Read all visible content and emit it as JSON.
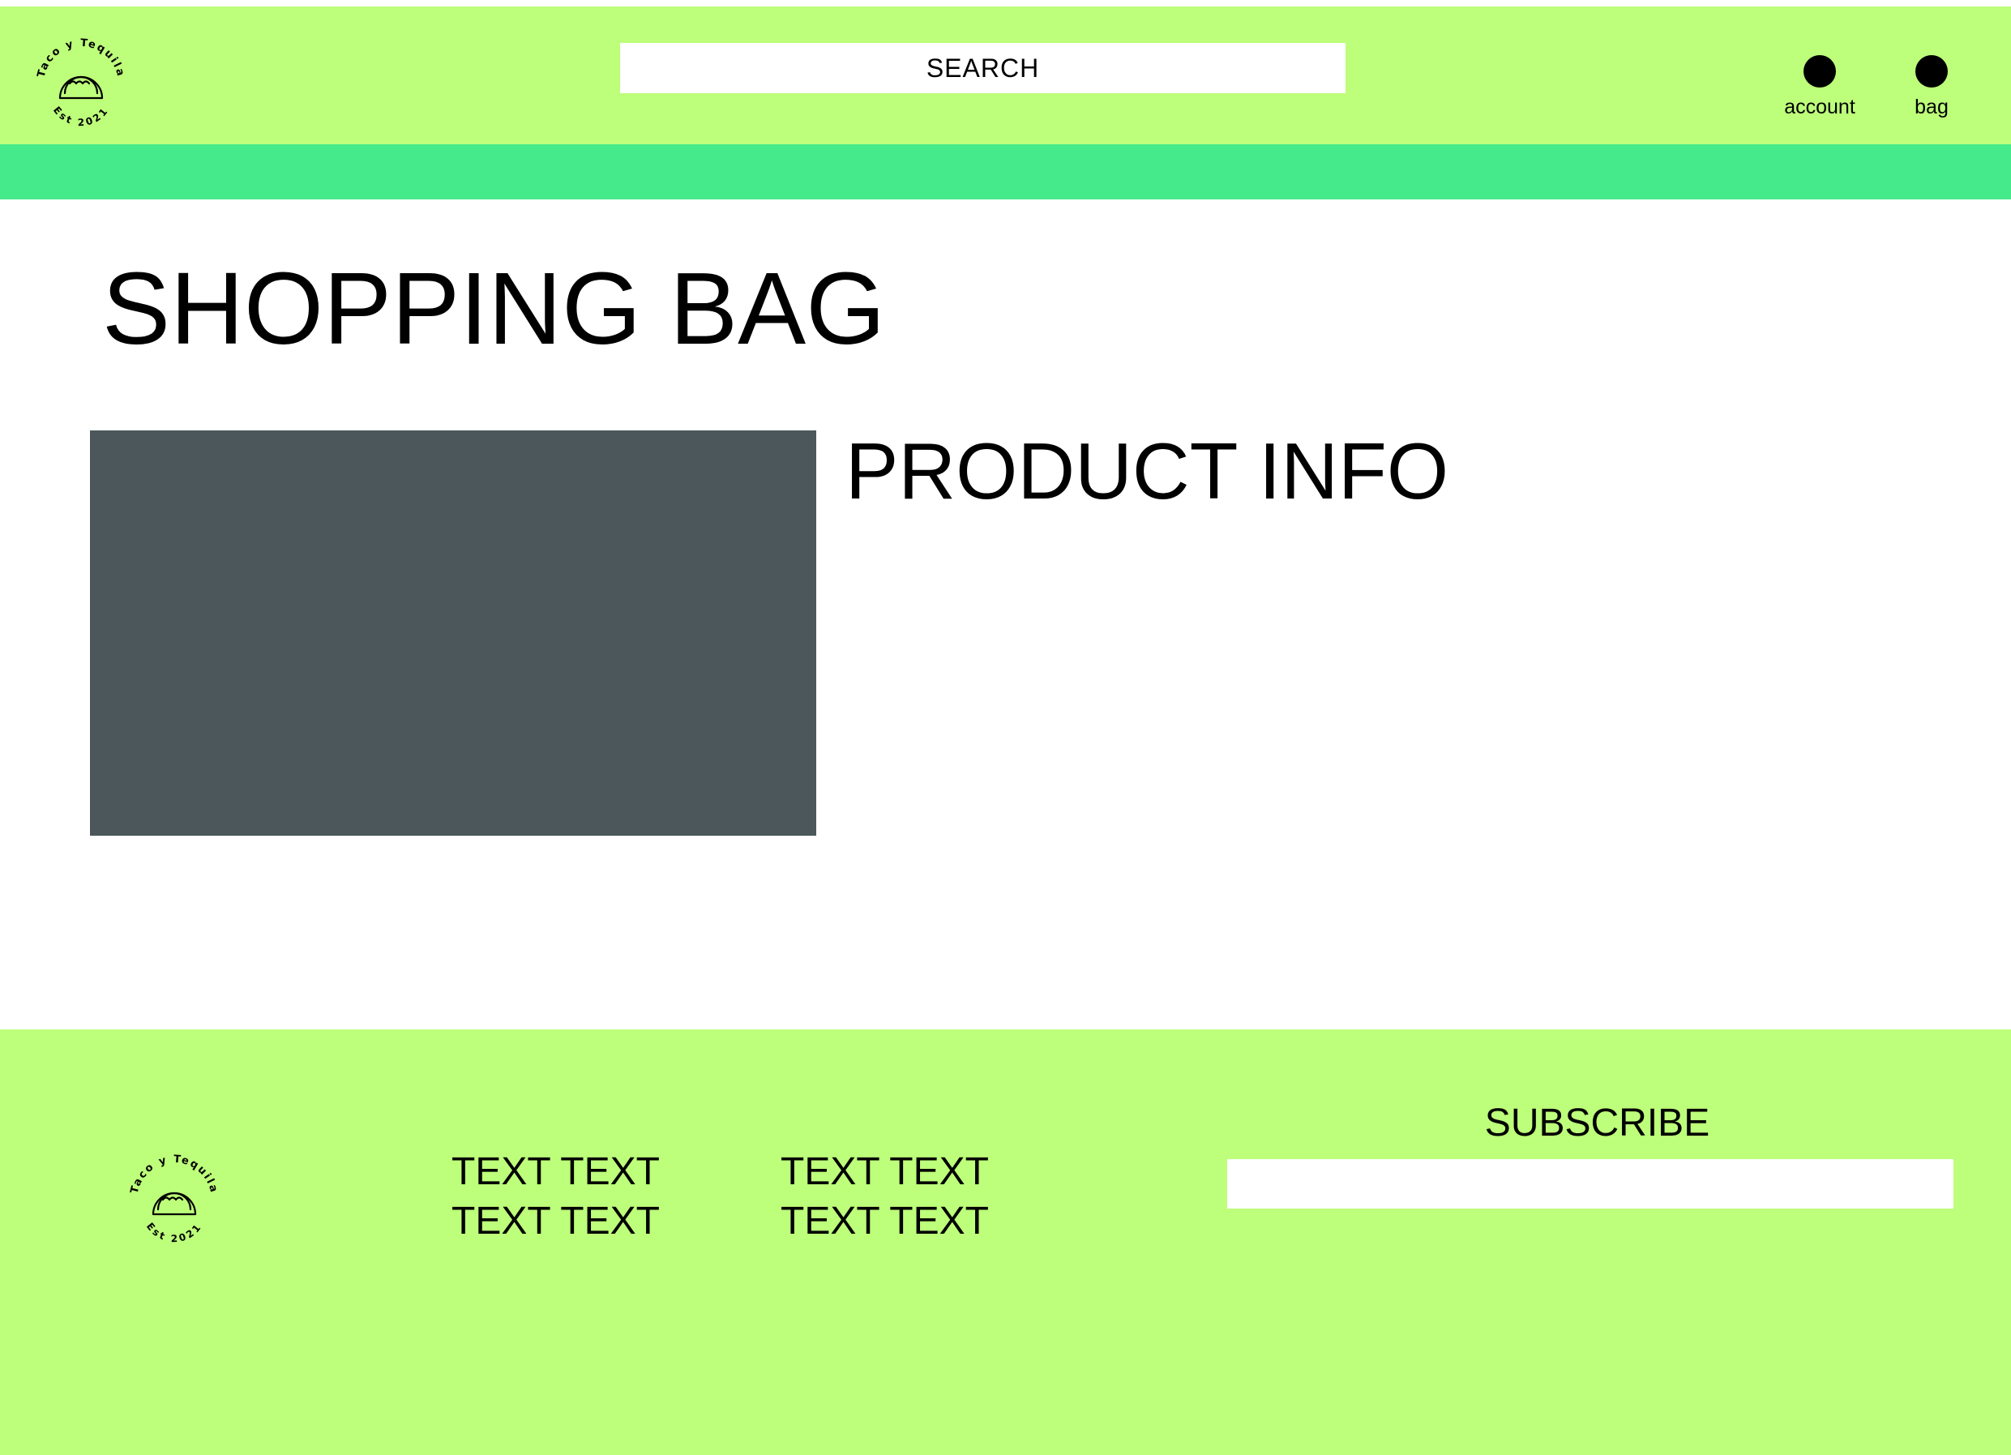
{
  "header": {
    "logo": {
      "top_text": "Taco y Tequila",
      "bottom_text": "Est 2021",
      "icon": "taco-icon"
    },
    "search": {
      "label": "SEARCH"
    },
    "nav": {
      "account_label": "account",
      "bag_label": "bag"
    }
  },
  "main": {
    "title": "SHOPPING BAG",
    "product": {
      "info_heading": "PRODUCT INFO"
    }
  },
  "footer": {
    "logo": {
      "top_text": "Taco y Tequila",
      "bottom_text": "Est 2021",
      "icon": "taco-icon"
    },
    "column_1": [
      "TEXT TEXT",
      "TEXT TEXT"
    ],
    "column_2": [
      "TEXT TEXT",
      "TEXT TEXT"
    ],
    "subscribe": {
      "label": "SUBSCRIBE",
      "input_value": ""
    }
  },
  "colors": {
    "header_bg": "#bdfe7a",
    "nav_bar": "#45ea8b",
    "footer_bg": "#bdfe7a",
    "image_placeholder": "#4b575b",
    "text": "#000000",
    "field_bg": "#ffffff"
  }
}
